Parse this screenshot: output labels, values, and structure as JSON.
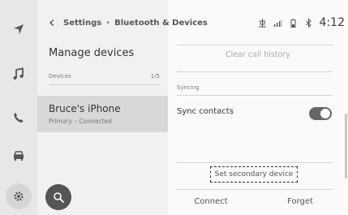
{
  "breadcrumb": {
    "parent": "Settings",
    "separator": "•",
    "current": "Bluetooth & Devices"
  },
  "status_bar": {
    "time": "4:12"
  },
  "left_panel": {
    "title": "Manage devices",
    "section": {
      "label": "Devices",
      "count": "1/5"
    },
    "devices": [
      {
        "name": "Bruce's iPhone",
        "status": "Primary – Connected",
        "selected": true
      }
    ]
  },
  "right_panel": {
    "clear_call_history": "Clear call history",
    "syncing_header": "Syncing",
    "sync_contacts": {
      "label": "Sync contacts",
      "enabled": true
    },
    "set_secondary": "Set secondary device",
    "connect": "Connect",
    "forget": "Forget"
  },
  "nav_rail": {
    "icons": [
      "navigation-icon",
      "music-icon",
      "phone-icon",
      "car-icon",
      "settings-icon"
    ]
  },
  "colors": {
    "selected_row": "#d8d8d8",
    "toggle_on": "#666666",
    "search_button": "#555555"
  }
}
